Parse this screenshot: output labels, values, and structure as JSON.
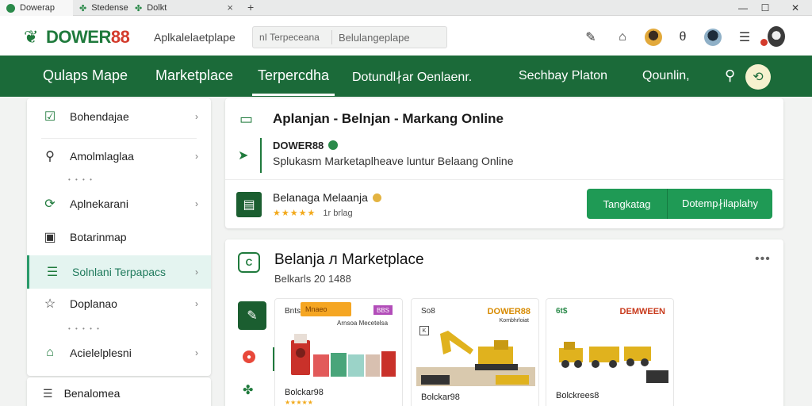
{
  "browser": {
    "tabs": [
      {
        "label": "Dowerap"
      },
      {
        "label": "Stedense"
      },
      {
        "label": "Dolkt"
      }
    ],
    "tab_close": "×",
    "new_tab": "+",
    "controls": {
      "minimize": "—",
      "maximize": "☐",
      "close": "✕"
    }
  },
  "header": {
    "logo_main": "DOWER",
    "logo_accent": "88",
    "tagline": "Aplkalelaetplape",
    "search": {
      "scope": "nI Terpeceana",
      "placeholder": "Belulangeplape"
    },
    "icons": [
      "tools-icon",
      "home-icon",
      "user-avatar",
      "theta-icon",
      "user-avatar-2",
      "menu-icon",
      "profile-avatar"
    ]
  },
  "nav": {
    "items": [
      "Qulaps Mape",
      "Marketplace",
      "Terpercdha",
      "Dotundl∤ar Oenlaenr.",
      "Sechbay Platon",
      "Qounlin,"
    ],
    "active_index": 2
  },
  "sidebar": {
    "items": [
      {
        "label": "Bohendajae",
        "icon": "check-square-icon"
      },
      {
        "label": "Amolmlaglaa",
        "icon": "search-icon"
      },
      {
        "label": "Aplnekarani",
        "icon": "refresh-icon"
      },
      {
        "label": "Botarinmap",
        "icon": "map-icon"
      },
      {
        "label": "Solnlani Terpapacs",
        "icon": "list-icon"
      },
      {
        "label": "Doplanao",
        "icon": "star-icon"
      },
      {
        "label": "Acielelplesni",
        "icon": "home-icon"
      }
    ],
    "active_index": 4,
    "footer_item": "Benalomea"
  },
  "app_card": {
    "title": "Aplanjan - Belnjan - Markang Online",
    "brand": "DOWER88",
    "description": "Splukasm Marketaplheave luntur Belaang Online",
    "app_name": "Belanaga Melaanja",
    "rating_text": "1r brlag",
    "stars": "★★★★★",
    "buttons": {
      "primary": "Tangkatag",
      "secondary": "Dotemp∤ilaplahy"
    }
  },
  "marketplace": {
    "title": "Belanja л Marketplace",
    "subtitle": "Belkarls 20 1488",
    "more": "•••",
    "products": [
      {
        "price": "Bnts",
        "tag": "Mnaeo",
        "tag2": "BBS",
        "label": "Arnsoa Mecetelsa",
        "name": "Bolckar98",
        "stars": "★★★★★"
      },
      {
        "price": "So8",
        "brand": "DOWER88",
        "brand_sub": "Kombhrloiat",
        "corner": "K",
        "name": "Bolckar98",
        "stars": ""
      },
      {
        "price": "6t$",
        "brand": "DEMWEEN",
        "name": "Bolckrees8",
        "stars": ""
      }
    ]
  },
  "colors": {
    "brand_green": "#1b6a39",
    "accent_green": "#1f9a55",
    "accent_red": "#d33b2c",
    "active_row": "#e4f4f0"
  }
}
